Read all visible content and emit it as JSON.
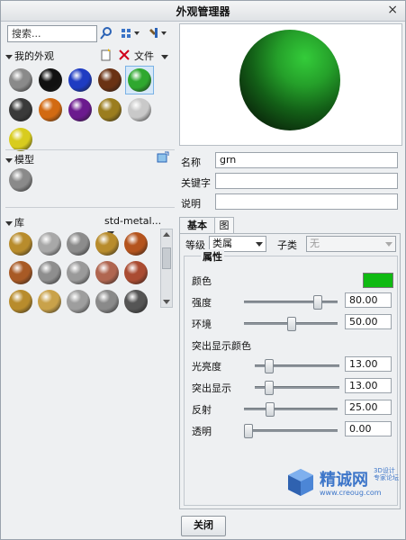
{
  "window": {
    "title": "外观管理器",
    "close_glyph": "×"
  },
  "left": {
    "search": {
      "value": "搜索..."
    },
    "my_appearances": {
      "label": "我的外观",
      "file_label": "文件",
      "spheres": [
        {
          "name": "gray",
          "color": "#8a8a8a"
        },
        {
          "name": "black",
          "color": "#111111"
        },
        {
          "name": "blue",
          "color": "#1f3cc2"
        },
        {
          "name": "brown",
          "color": "#6a3214"
        },
        {
          "name": "grn",
          "color": "#2fa82f",
          "selected": true
        },
        {
          "name": "dark-gray",
          "color": "#3a3a3a"
        },
        {
          "name": "orange",
          "color": "#d26a12"
        },
        {
          "name": "purple",
          "color": "#6b1a8e"
        },
        {
          "name": "gold",
          "color": "#9b7d1e"
        },
        {
          "name": "light-gray",
          "color": "#c9c9c9"
        },
        {
          "name": "yellow",
          "color": "#d8cc1e"
        }
      ]
    },
    "model": {
      "label": "模型",
      "spheres": [
        {
          "name": "model-gray",
          "color": "#8a8a8a"
        }
      ]
    },
    "library": {
      "label": "库",
      "dropdown_value": "std-metal...",
      "spheres": [
        {
          "color": "#b88c2c"
        },
        {
          "color": "#a8a8a8"
        },
        {
          "color": "#8c8c8c"
        },
        {
          "color": "#b88c2c"
        },
        {
          "color": "#b4541e"
        },
        {
          "color": "#a85a25"
        },
        {
          "color": "#8e8e8e"
        },
        {
          "color": "#9a9a9a"
        },
        {
          "color": "#b06650"
        },
        {
          "color": "#aa4c32"
        },
        {
          "color": "#b88c2c"
        },
        {
          "color": "#c9a24a"
        },
        {
          "color": "#9e9e9e"
        },
        {
          "color": "#8a8a8a"
        },
        {
          "color": "#555555"
        }
      ]
    }
  },
  "right": {
    "fields": {
      "name": {
        "label": "名称",
        "value": "grn"
      },
      "keywords": {
        "label": "关键字",
        "value": ""
      },
      "description": {
        "label": "说明",
        "value": ""
      }
    },
    "tabs": [
      {
        "label": "基本"
      },
      {
        "label": "图"
      }
    ],
    "class": {
      "label": "等级",
      "value": "类属"
    },
    "subclass": {
      "label": "子类",
      "value": "无"
    },
    "properties": {
      "title": "属性",
      "color_label": "颜色",
      "color": "#0fba12",
      "intensity": {
        "label": "强度",
        "value": "80.00",
        "level": 0.8
      },
      "ambient": {
        "label": "环境",
        "value": "50.00",
        "level": 0.5
      },
      "highlight_color_label": "突出显示颜色",
      "shine": {
        "label": "光亮度",
        "value": "13.00",
        "level": 0.13
      },
      "highlight": {
        "label": "突出显示",
        "value": "13.00",
        "level": 0.13
      },
      "reflection": {
        "label": "反射",
        "value": "25.00",
        "level": 0.25
      },
      "transparency": {
        "label": "透明",
        "value": "0.00",
        "level": 0.0
      }
    }
  },
  "footer": {
    "close_label": "关闭"
  },
  "watermark": {
    "name": "精诚网",
    "tag_line1": "3D设计",
    "tag_line2": "专家论坛",
    "url": "www.creoug.com"
  }
}
